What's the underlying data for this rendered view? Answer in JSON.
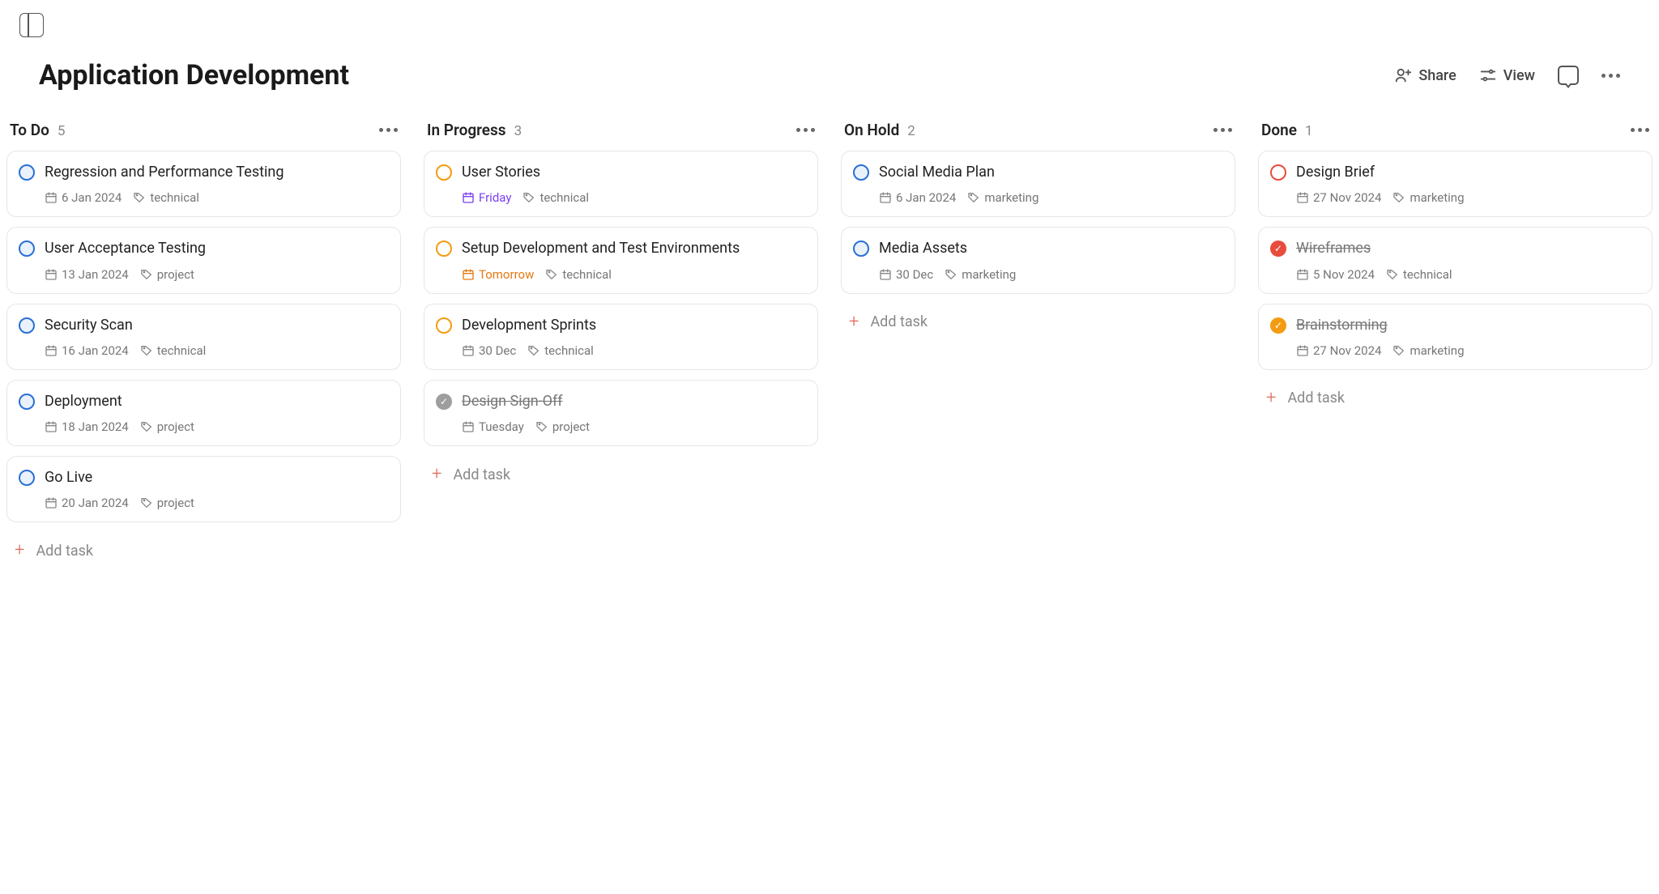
{
  "header": {
    "title": "Application Development",
    "share_label": "Share",
    "view_label": "View"
  },
  "add_task_label": "Add task",
  "columns": [
    {
      "name": "To Do",
      "count": "5",
      "cards": [
        {
          "title": "Regression and Performance Testing",
          "status": "blue",
          "date": "6 Jan 2024",
          "tag": "technical",
          "date_style": "",
          "struck": false
        },
        {
          "title": "User Acceptance Testing",
          "status": "blue",
          "date": "13 Jan 2024",
          "tag": "project",
          "date_style": "",
          "struck": false
        },
        {
          "title": "Security Scan",
          "status": "blue",
          "date": "16 Jan 2024",
          "tag": "technical",
          "date_style": "",
          "struck": false
        },
        {
          "title": "Deployment",
          "status": "blue",
          "date": "18 Jan 2024",
          "tag": "project",
          "date_style": "",
          "struck": false
        },
        {
          "title": "Go Live",
          "status": "blue",
          "date": "20 Jan 2024",
          "tag": "project",
          "date_style": "",
          "struck": false
        }
      ]
    },
    {
      "name": "In Progress",
      "count": "3",
      "cards": [
        {
          "title": "User Stories",
          "status": "orange",
          "date": "Friday",
          "tag": "technical",
          "date_style": "purple",
          "struck": false
        },
        {
          "title": "Setup Development and Test Environments",
          "status": "orange",
          "date": "Tomorrow",
          "tag": "technical",
          "date_style": "orange",
          "struck": false
        },
        {
          "title": "Development Sprints",
          "status": "orange",
          "date": "30 Dec",
          "tag": "technical",
          "date_style": "",
          "struck": false
        },
        {
          "title": "Design Sign-Off",
          "status": "check-gray",
          "date": "Tuesday",
          "tag": "project",
          "date_style": "",
          "struck": true
        }
      ]
    },
    {
      "name": "On Hold",
      "count": "2",
      "cards": [
        {
          "title": "Social Media Plan",
          "status": "blue",
          "date": "6 Jan 2024",
          "tag": "marketing",
          "date_style": "",
          "struck": false
        },
        {
          "title": "Media Assets",
          "status": "blue",
          "date": "30 Dec",
          "tag": "marketing",
          "date_style": "",
          "struck": false
        }
      ]
    },
    {
      "name": "Done",
      "count": "1",
      "cards": [
        {
          "title": "Design Brief",
          "status": "red",
          "date": "27 Nov 2024",
          "tag": "marketing",
          "date_style": "",
          "struck": false
        },
        {
          "title": "Wireframes",
          "status": "check-red",
          "date": "5 Nov 2024",
          "tag": "technical",
          "date_style": "",
          "struck": true
        },
        {
          "title": "Brainstorming",
          "status": "check-orange",
          "date": "27 Nov 2024",
          "tag": "marketing",
          "date_style": "",
          "struck": true
        }
      ]
    }
  ]
}
